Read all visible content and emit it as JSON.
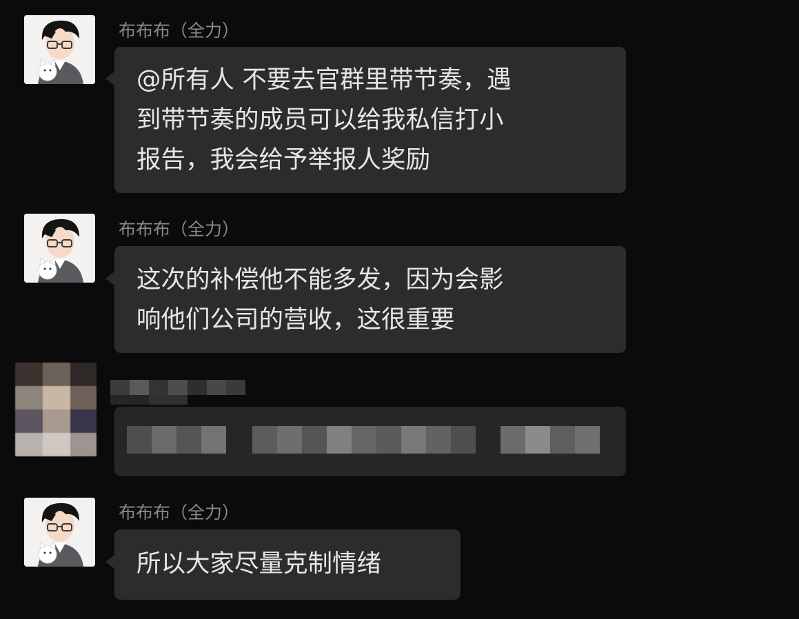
{
  "messages": [
    {
      "sender": "布布布（全力）",
      "avatar_icon": "cartoon-boy-with-glasses-and-white-cat-avatar",
      "lines": [
        "@所有人  不要去官群里带节奏，遇",
        "到带节奏的成员可以给我私信打小",
        "报告，我会给予举报人奖励"
      ]
    },
    {
      "sender": "布布布（全力）",
      "avatar_icon": "cartoon-boy-with-glasses-and-white-cat-avatar",
      "lines": [
        "这次的补偿他不能多发，因为会影",
        "响他们公司的营收，这很重要"
      ]
    },
    {
      "redacted": true,
      "avatar_icon": "pixelated-avatar"
    },
    {
      "sender": "布布布（全力）",
      "avatar_icon": "cartoon-boy-with-glasses-and-white-cat-avatar",
      "lines": [
        "所以大家尽量克制情绪"
      ]
    }
  ],
  "colors": {
    "background": "#0c0b0c",
    "bubble": "#2c2c2c",
    "bubble_text": "#e6e6e6",
    "sender_text": "#8a8a8a"
  }
}
